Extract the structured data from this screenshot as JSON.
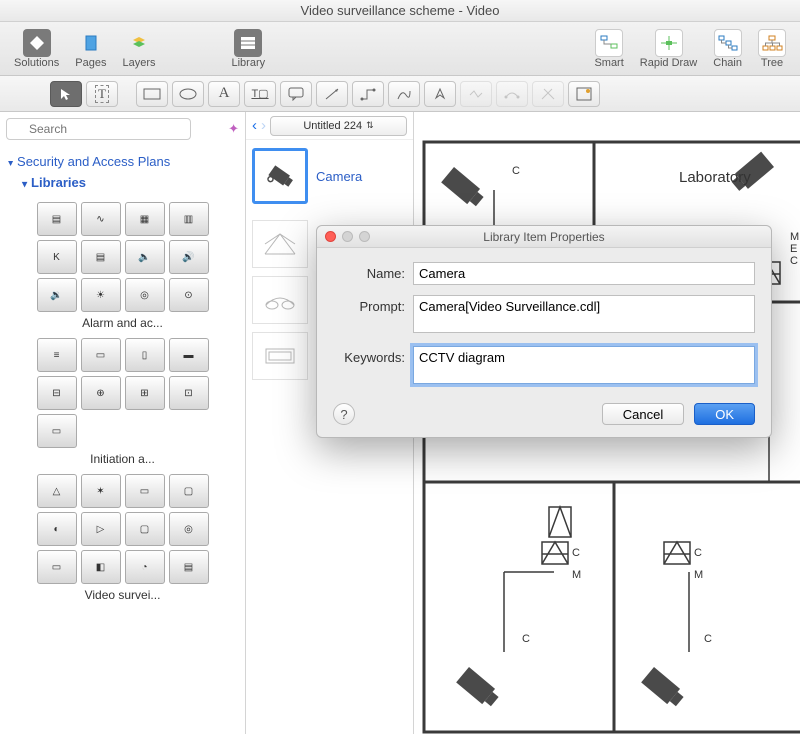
{
  "window": {
    "title": "Video surveillance scheme - Video"
  },
  "toolbar": {
    "left": [
      {
        "label": "Solutions",
        "active": true
      },
      {
        "label": "Pages"
      },
      {
        "label": "Layers"
      }
    ],
    "mid": [
      {
        "label": "Library",
        "active": true
      }
    ],
    "right": [
      {
        "label": "Smart"
      },
      {
        "label": "Rapid Draw"
      },
      {
        "label": "Chain"
      },
      {
        "label": "Tree"
      }
    ]
  },
  "search": {
    "placeholder": "Search"
  },
  "sidebar": {
    "section": "Security and Access Plans",
    "sub": "Libraries",
    "groups": [
      {
        "label": "Alarm and ac..."
      },
      {
        "label": "Initiation a..."
      },
      {
        "label": "Video survei..."
      }
    ]
  },
  "browser": {
    "back": "‹",
    "forward": "›",
    "doc": "Untitled 224",
    "item_label": "Camera"
  },
  "canvas": {
    "room_label": "Laboratory"
  },
  "dialog": {
    "title": "Library Item Properties",
    "labels": {
      "name": "Name:",
      "prompt": "Prompt:",
      "keywords": "Keywords:"
    },
    "values": {
      "name": "Camera",
      "prompt": "Camera[Video Surveillance.cdl]",
      "keywords": "CCTV diagram"
    },
    "buttons": {
      "cancel": "Cancel",
      "ok": "OK",
      "help": "?"
    }
  }
}
